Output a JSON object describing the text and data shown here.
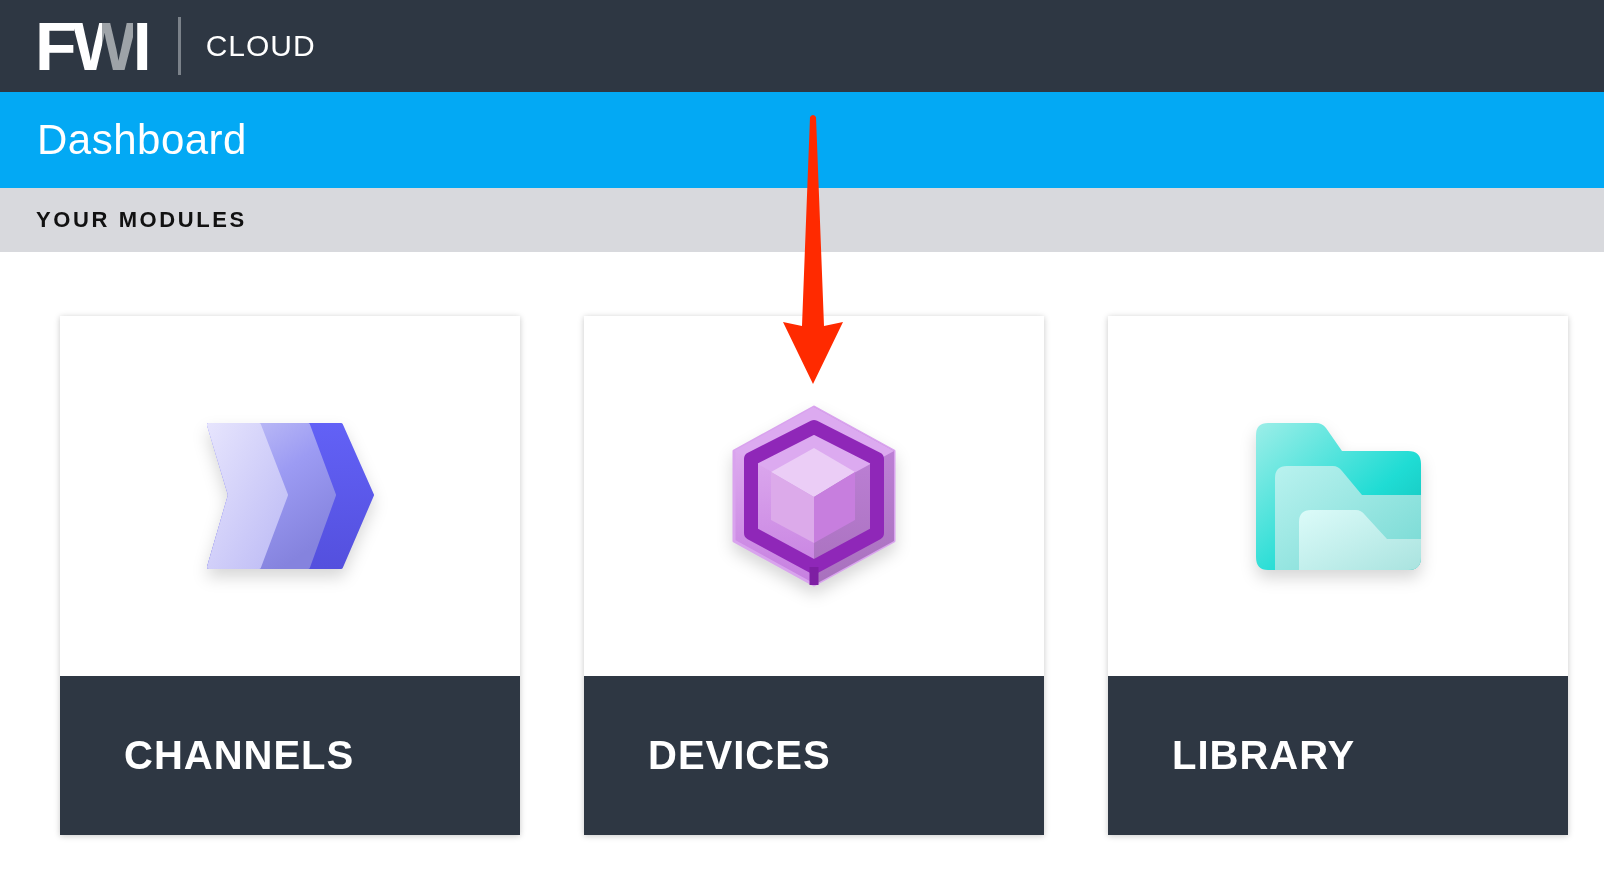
{
  "header": {
    "logo": "FWI",
    "product": "CLOUD"
  },
  "page": {
    "title": "Dashboard"
  },
  "section": {
    "heading": "YOUR MODULES"
  },
  "modules": [
    {
      "label": "CHANNELS",
      "kind": "channels"
    },
    {
      "label": "DEVICES",
      "kind": "devices"
    },
    {
      "label": "LIBRARY",
      "kind": "library"
    }
  ]
}
